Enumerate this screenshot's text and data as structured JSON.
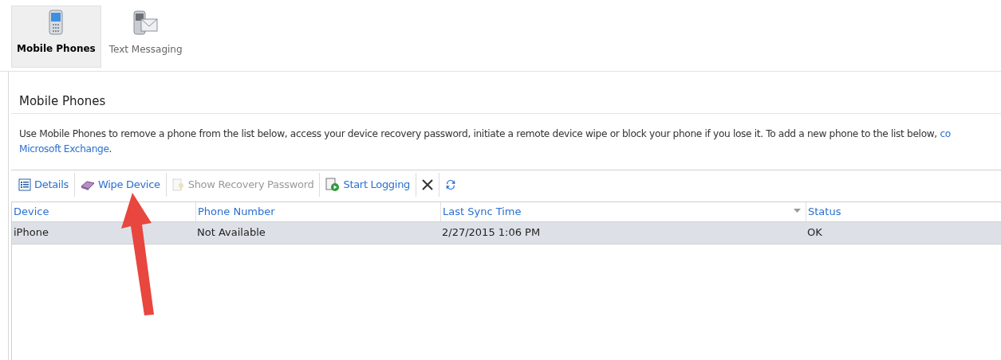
{
  "tabs": [
    {
      "label": "Mobile Phones",
      "kind": "phone",
      "selected": true
    },
    {
      "label": "Text Messaging",
      "kind": "message",
      "selected": false
    }
  ],
  "section_title": "Mobile Phones",
  "description": {
    "text": "Use Mobile Phones to remove a phone from the list below, access your device recovery password, initiate a remote device wipe or block your phone if you lose it. To add a new phone to the list below, ",
    "link_cut": "co",
    "link": "Microsoft Exchange",
    "end": "."
  },
  "toolbar": [
    {
      "label": "Details",
      "kind": "details",
      "disabled": false
    },
    {
      "label": "Wipe Device",
      "kind": "wipe",
      "disabled": false
    },
    {
      "label": "Show Recovery Password",
      "kind": "password",
      "disabled": true
    },
    {
      "label": "Start Logging",
      "kind": "logging",
      "disabled": false
    },
    {
      "kind": "delete",
      "disabled": false
    },
    {
      "kind": "refresh",
      "disabled": false
    }
  ],
  "table": {
    "columns": [
      {
        "label": "Device",
        "sorted": false
      },
      {
        "label": "Phone Number",
        "sorted": false
      },
      {
        "label": "Last Sync Time",
        "sorted": true
      },
      {
        "label": "Status",
        "sorted": false
      }
    ],
    "rows": [
      {
        "cells": [
          "iPhone",
          "Not Available",
          "2/27/2015 1:06 PM",
          "OK"
        ],
        "selected": true
      }
    ]
  },
  "annotation": {
    "kind": "arrow"
  }
}
